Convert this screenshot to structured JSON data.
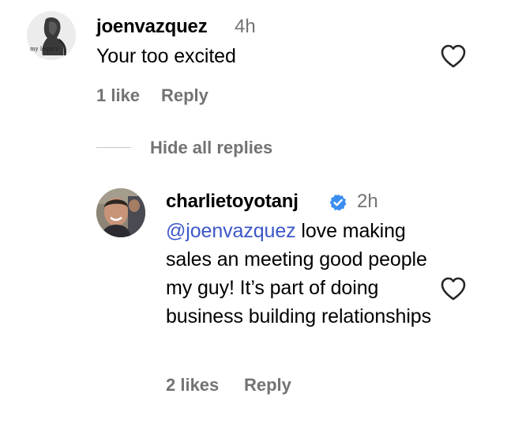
{
  "comment": {
    "username": "joenvazquez",
    "time": "4h",
    "text": "Your too excited",
    "likes": "1 like",
    "reply_label": "Reply",
    "avatar_caption": "my legacy"
  },
  "hide_replies_label": "Hide all replies",
  "reply": {
    "username": "charlietoyotanj",
    "time": "2h",
    "mention": "@joenvazquez",
    "text_line1": " love",
    "text_rest": "making sales an meeting good people my guy! It’s part of doing business building relationships",
    "likes": "2 likes",
    "reply_label": "Reply"
  },
  "colors": {
    "secondary_text": "#737373",
    "mention": "#3c57c9",
    "verified": "#3b8ef0"
  },
  "icons": {
    "like": "heart-outline-icon",
    "verified": "verified-badge-icon"
  }
}
